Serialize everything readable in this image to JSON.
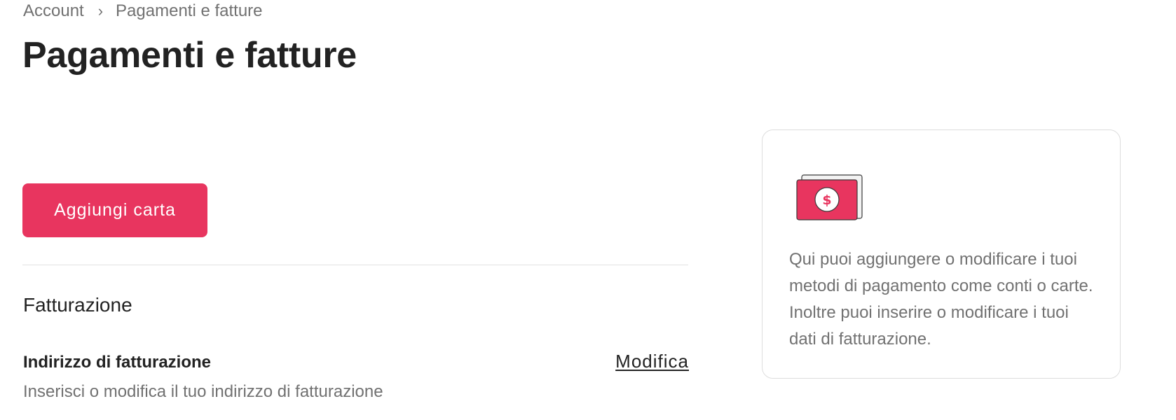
{
  "breadcrumb": {
    "root": "Account",
    "separator": "›",
    "current": "Pagamenti e fatture"
  },
  "page": {
    "title": "Pagamenti e fatture"
  },
  "actions": {
    "add_card_label": "Aggiungi carta"
  },
  "billing": {
    "section_title": "Fatturazione",
    "address_label": "Indirizzo di fatturazione",
    "address_description": "Inserisci o modifica il tuo indirizzo di fatturazione",
    "edit_label": "Modifica"
  },
  "info_card": {
    "icon": "money-card-icon",
    "text": "Qui puoi aggiungere o modificare i tuoi metodi di pagamento come conti o carte. Inoltre puoi inserire o modificare i tuoi dati di fatturazione."
  },
  "colors": {
    "accent": "#e8355f",
    "text_primary": "#222222",
    "text_secondary": "#717171",
    "border": "#dddddd"
  }
}
